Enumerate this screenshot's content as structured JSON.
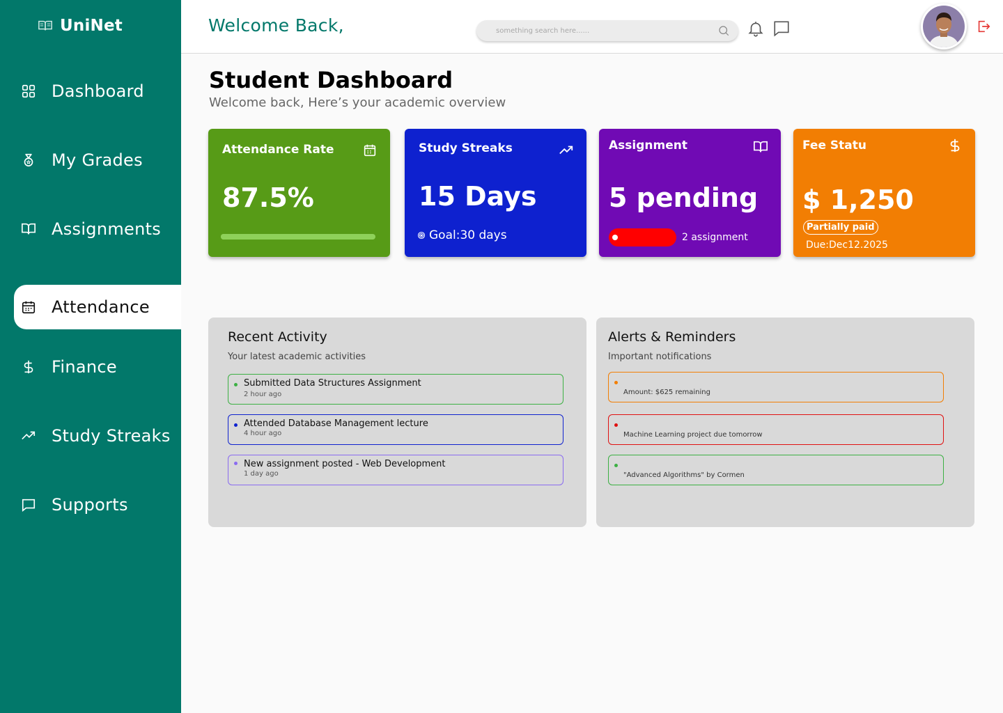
{
  "app": {
    "name": "UniNet"
  },
  "sidebar": {
    "items": [
      {
        "label": "Dashboard",
        "icon": "grid-icon"
      },
      {
        "label": "My Grades",
        "icon": "medal-icon"
      },
      {
        "label": "Assignments",
        "icon": "book-icon"
      },
      {
        "label": "Attendance",
        "icon": "calendar-icon",
        "active": true
      },
      {
        "label": "Finance",
        "icon": "dollar-icon"
      },
      {
        "label": "Study Streaks",
        "icon": "trending-up-icon"
      },
      {
        "label": "Supports",
        "icon": "message-icon"
      }
    ]
  },
  "header": {
    "welcome": "Welcome Back,",
    "search_placeholder": "something search here......"
  },
  "page": {
    "title": "Student Dashboard",
    "subtitle": "Welcome back, Here’s your academic overview"
  },
  "cards": {
    "attendance": {
      "title": "Attendance Rate",
      "value": "87.5%",
      "progress": 0.875
    },
    "streaks": {
      "title": "Study Streaks",
      "value": "15 Days",
      "goal": "Goal:30 days"
    },
    "assignment": {
      "title": "Assignment",
      "value": "5 pending",
      "note": "2 assignment"
    },
    "fee": {
      "title": "Fee Statu",
      "value": "$ 1,250",
      "badge": "Partially paid",
      "due": "Due:Dec12.2025"
    }
  },
  "recent_activity": {
    "title": "Recent Activity",
    "subtitle": "Your latest academic activities",
    "items": [
      {
        "title": "Submitted Data Structures Assignment",
        "time": "2 hour ago",
        "color": "#3cb043"
      },
      {
        "title": "Attended Database Management lecture",
        "time": "4 hour ago",
        "color": "#0e21cf"
      },
      {
        "title": "New assignment posted - Web Development",
        "time": "1 day ago",
        "color": "#8a6bf0"
      }
    ]
  },
  "alerts": {
    "title": "Alerts & Reminders",
    "subtitle": "Important notifications",
    "items": [
      {
        "text": "Amount: $625 remaining",
        "color": "#f27e03"
      },
      {
        "text": "Machine Learning project due tomorrow",
        "color": "#e01010"
      },
      {
        "text": "\"Advanced Algorithms\" by Cormen",
        "color": "#3cb043"
      }
    ]
  }
}
